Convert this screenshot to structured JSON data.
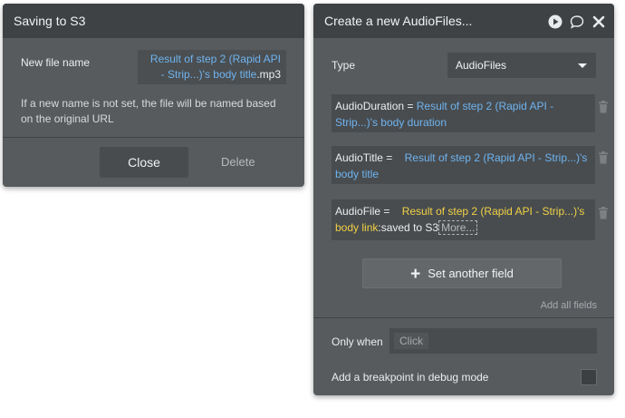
{
  "left_panel": {
    "title": "Saving to S3",
    "file_name_label": "New file name",
    "file_name_expr_part1": "Result of step 2 (Rapid API",
    "file_name_expr_part2": "- Strip...)'s body title",
    "file_name_suffix": ".mp3",
    "note_line1": "If a new name is not set, the file will be named based",
    "note_line2": "on the original URL",
    "close_label": "Close",
    "delete_label": "Delete"
  },
  "right_panel": {
    "title": "Create a new AudioFiles...",
    "icons": [
      "play-icon",
      "comment-icon",
      "close-icon"
    ],
    "type_label": "Type",
    "type_value": "AudioFiles",
    "fields": [
      {
        "name": "AudioDuration",
        "eq": " = ",
        "expr_a": "Result of step 2 (Rapid API -",
        "expr_b": "Strip...)'s body duration"
      },
      {
        "name": "AudioTitle",
        "eq": " = ",
        "expr_a": "Result of step 2 (Rapid API - Strip...)'s",
        "expr_b": "body title"
      },
      {
        "name": "AudioFile",
        "eq": " = ",
        "expr_a": "Result of step 2 (Rapid API - Strip...)'s",
        "expr_b": "body link",
        "suffix": ":saved to S3",
        "more": "More..."
      }
    ],
    "set_field_label": "Set another field",
    "add_all_label": "Add all fields",
    "only_when_label": "Only when",
    "only_when_placeholder": "Click",
    "breakpoint_label": "Add a breakpoint in debug mode"
  },
  "colors": {
    "panel": "#575b5e",
    "header": "#3e4245",
    "expression_blue": "#6fb3ef",
    "expression_yellow": "#f0d046"
  }
}
